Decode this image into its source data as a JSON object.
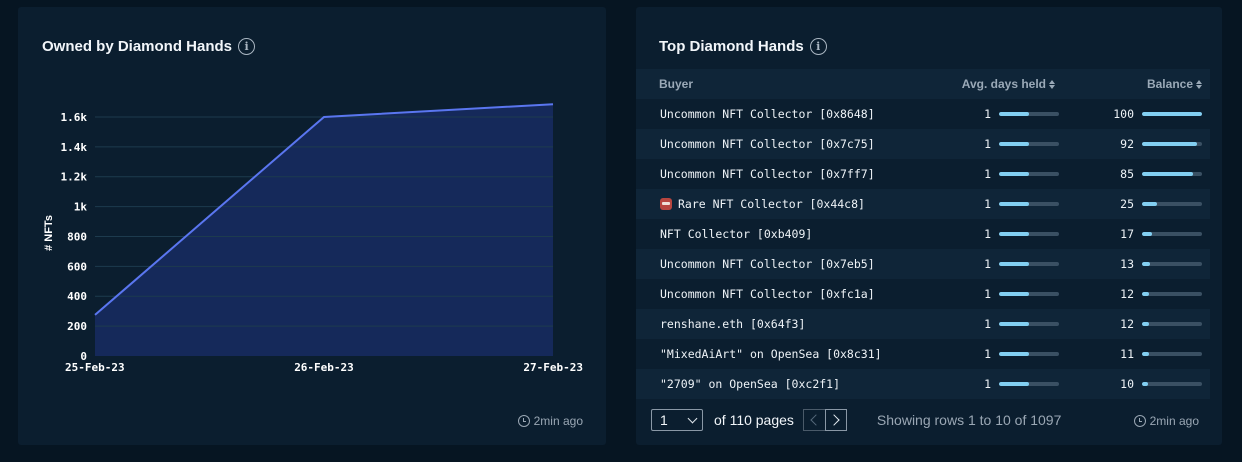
{
  "left_panel": {
    "title": "Owned by Diamond Hands",
    "info_icon": "info-icon",
    "updated": "2min ago"
  },
  "chart_data": {
    "type": "area",
    "title": "Owned by Diamond Hands",
    "xlabel": "",
    "ylabel": "# NFTs",
    "x": [
      "25-Feb-23",
      "26-Feb-23",
      "27-Feb-23"
    ],
    "series": [
      {
        "values": [
          275,
          1600,
          1685
        ]
      }
    ],
    "ylim": [
      0,
      1700
    ],
    "yticks": [
      0,
      200,
      400,
      600,
      800,
      1000,
      1200,
      1400,
      1600
    ],
    "ytick_labels": [
      "0",
      "200",
      "400",
      "600",
      "800",
      "1k",
      "1.2k",
      "1.4k",
      "1.6k"
    ],
    "grid": true,
    "colors": {
      "line": "#5a76f0",
      "fill": "#15295a",
      "grid": "#1d3b4e"
    }
  },
  "right_panel": {
    "title": "Top Diamond Hands",
    "info_icon": "info-icon",
    "updated": "2min ago",
    "columns": {
      "buyer": "Buyer",
      "days": "Avg. days held",
      "balance": "Balance"
    },
    "rows": [
      {
        "buyer": "Uncommon NFT Collector [0x8648]",
        "days": "1",
        "days_frac": 0.5,
        "balance": "100",
        "bal_frac": 1.0
      },
      {
        "buyer": "Uncommon NFT Collector [0x7c75]",
        "days": "1",
        "days_frac": 0.5,
        "balance": "92",
        "bal_frac": 0.92
      },
      {
        "buyer": "Uncommon NFT Collector [0x7ff7]",
        "days": "1",
        "days_frac": 0.5,
        "balance": "85",
        "bal_frac": 0.85
      },
      {
        "buyer": "Rare NFT Collector [0x44c8]",
        "icon": "rare-collector-icon",
        "days": "1",
        "days_frac": 0.5,
        "balance": "25",
        "bal_frac": 0.25
      },
      {
        "buyer": "NFT Collector [0xb409]",
        "days": "1",
        "days_frac": 0.5,
        "balance": "17",
        "bal_frac": 0.17
      },
      {
        "buyer": "Uncommon NFT Collector [0x7eb5]",
        "days": "1",
        "days_frac": 0.5,
        "balance": "13",
        "bal_frac": 0.13
      },
      {
        "buyer": "Uncommon NFT Collector [0xfc1a]",
        "days": "1",
        "days_frac": 0.5,
        "balance": "12",
        "bal_frac": 0.12
      },
      {
        "buyer": "renshane.eth [0x64f3]",
        "days": "1",
        "days_frac": 0.5,
        "balance": "12",
        "bal_frac": 0.12
      },
      {
        "buyer": "\"MixedAiArt\" on OpenSea [0x8c31]",
        "days": "1",
        "days_frac": 0.5,
        "balance": "11",
        "bal_frac": 0.11
      },
      {
        "buyer": "\"2709\" on OpenSea [0xc2f1]",
        "days": "1",
        "days_frac": 0.5,
        "balance": "10",
        "bal_frac": 0.1
      }
    ],
    "pagination": {
      "current_page": "1",
      "of_pages": "of 110 pages",
      "rows_info": "Showing rows 1 to 10 of 1097"
    },
    "colors": {
      "bar_fill": "#82cff2",
      "bar_track": "#3a5063"
    }
  }
}
